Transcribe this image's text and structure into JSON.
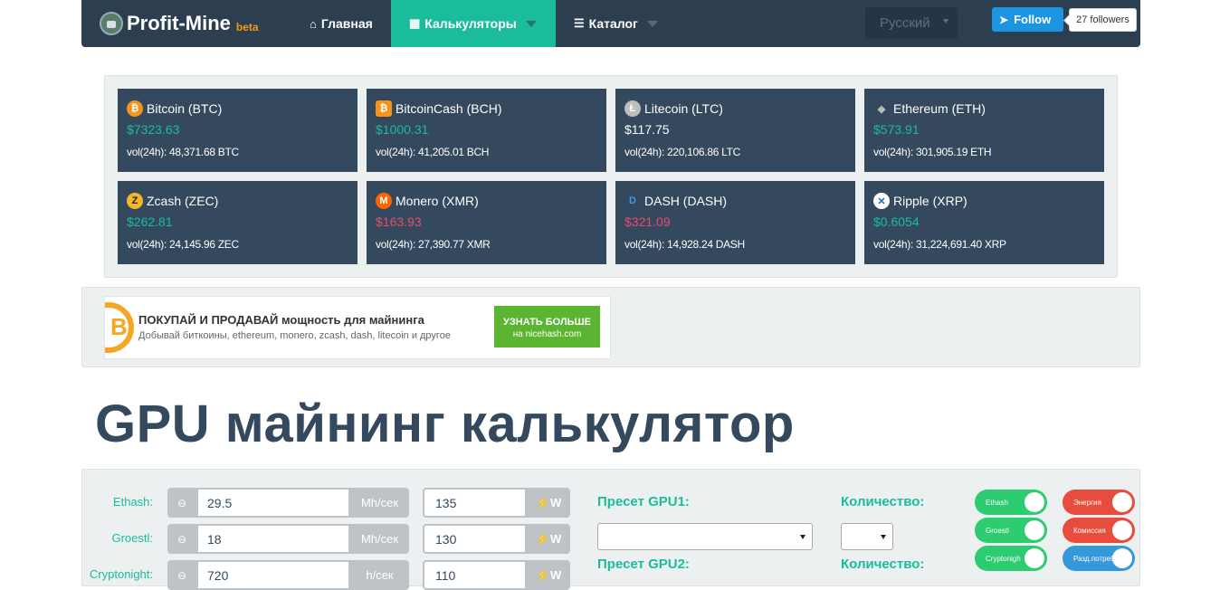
{
  "nav": {
    "brand": "Profit-Mine",
    "beta": "beta",
    "home": "Главная",
    "calculators": "Калькуляторы",
    "catalog": "Каталог",
    "language": "Русский",
    "follow": "Follow",
    "followers": "27 followers"
  },
  "coins": [
    {
      "name": "Bitcoin (BTC)",
      "price": "$7323.63",
      "vol": "vol(24h): 48,371.68 BTC",
      "price_color": "#1abc9c",
      "icon_color": "#f7931a",
      "icon": "bitcoin-icon"
    },
    {
      "name": "BitcoinCash (BCH)",
      "price": "$1000.31",
      "vol": "vol(24h): 41,205.01 BCH",
      "price_color": "#1abc9c",
      "icon_color": "#f7931a",
      "icon": "bitcoin-cash-icon"
    },
    {
      "name": "Litecoin (LTC)",
      "price": "$117.75",
      "vol": "vol(24h): 220,106.86 LTC",
      "price_color": "#ffffff",
      "icon_color": "#bebebe",
      "icon": "litecoin-icon"
    },
    {
      "name": "Ethereum (ETH)",
      "price": "$573.91",
      "vol": "vol(24h): 301,905.19 ETH",
      "price_color": "#1abc9c",
      "icon_color": "#343434",
      "icon": "ethereum-icon"
    },
    {
      "name": "Zcash (ZEC)",
      "price": "$262.81",
      "vol": "vol(24h): 24,145.96 ZEC",
      "price_color": "#1abc9c",
      "icon_color": "#f4b728",
      "icon": "zcash-icon"
    },
    {
      "name": "Monero (XMR)",
      "price": "$163.93",
      "vol": "vol(24h): 27,390.77 XMR",
      "price_color": "#e74c6c",
      "icon_color": "#ff6600",
      "icon": "monero-icon"
    },
    {
      "name": "DASH (DASH)",
      "price": "$321.09",
      "vol": "vol(24h): 14,928.24 DASH",
      "price_color": "#e74c6c",
      "icon_color": "#1c75bc",
      "icon": "dash-icon"
    },
    {
      "name": "Ripple (XRP)",
      "price": "$0.6054",
      "vol": "vol(24h): 31,224,691.40 XRP",
      "price_color": "#1abc9c",
      "icon_color": "#ffffff",
      "icon": "ripple-icon"
    }
  ],
  "banner": {
    "title": "ПОКУПАЙ И ПРОДАВАЙ  мощность для майнинга",
    "subtitle": "Добывай биткоины, ethereum, monero, zcash, dash, litecoin и другое",
    "button_line1": "УЗНАТЬ БОЛЬШЕ",
    "button_line2": "на nicehash.com"
  },
  "page_title": "GPU майнинг калькулятор",
  "algos": [
    {
      "label": "Ethash:",
      "hashrate": "29.5",
      "unit": "Mh/сек",
      "watts": "135",
      "watt_unit": "W"
    },
    {
      "label": "Groestl:",
      "hashrate": "18",
      "unit": "Mh/сек",
      "watts": "130",
      "watt_unit": "W"
    },
    {
      "label": "Cryptonight:",
      "hashrate": "720",
      "unit": "h/сек",
      "watts": "110",
      "watt_unit": "W"
    }
  ],
  "presets": {
    "gpu1_label": "Пресет GPU1:",
    "gpu2_label": "Пресет GPU2:",
    "qty_label": "Количество:"
  },
  "toggles": [
    {
      "label": "Ethash",
      "color": "green"
    },
    {
      "label": "Энергия",
      "color": "red"
    },
    {
      "label": "Groestl",
      "color": "green"
    },
    {
      "label": "Комиссия",
      "color": "red"
    },
    {
      "label": "Cryptonigh",
      "color": "green"
    },
    {
      "label": "Разд.потребл",
      "color": "blue"
    }
  ]
}
